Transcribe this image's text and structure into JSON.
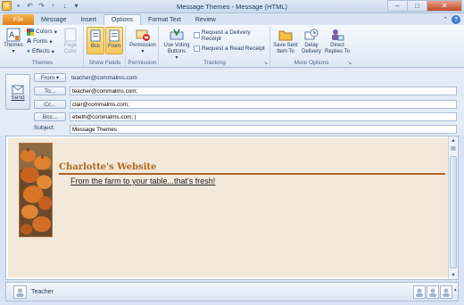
{
  "window": {
    "title": "Message Themes - Message (HTML)"
  },
  "tabs": [
    "File",
    "Message",
    "Insert",
    "Options",
    "Format Text",
    "Review"
  ],
  "active_tab": "Options",
  "ribbon": {
    "themes": {
      "themes_label": "Themes",
      "colors_label": "Colors",
      "fonts_label": "Fonts",
      "effects_label": "Effects",
      "page_color_label": "Page Color",
      "group_label": "Themes"
    },
    "show_fields": {
      "bcc_label": "Bcc",
      "from_label": "From",
      "group_label": "Show Fields"
    },
    "permission": {
      "permission_label": "Permission",
      "group_label": "Permission"
    },
    "tracking": {
      "voting_label": "Use Voting Buttons",
      "delivery_label": "Request a Delivery Receipt",
      "read_label": "Request a Read Receipt",
      "group_label": "Tracking"
    },
    "more_options": {
      "save_sent_label": "Save Sent Item To",
      "delay_label": "Delay Delivery",
      "direct_label": "Direct Replies To",
      "group_label": "More Options"
    }
  },
  "header": {
    "send_label": "Send",
    "from_label": "From",
    "from_value": "teacher@commalms.com",
    "to_label": "To...",
    "to_value": "teacher@commalms.com;",
    "cc_label": "Cc...",
    "cc_value": "clair@commalms.com;",
    "bcc_label": "Bcc...",
    "bcc_value": "ebeth@commalms.com; |",
    "subject_label": "Subject:",
    "subject_value": "Message Themes"
  },
  "message_body": {
    "site_title": "Charlotte's Website",
    "tagline": "From the farm to your table...that's fresh!"
  },
  "people_pane": {
    "name": "Teacher"
  },
  "colors": {
    "file_tab": "#e27c1b",
    "accent": "#b5651d",
    "page_background": "#f3e9db"
  }
}
